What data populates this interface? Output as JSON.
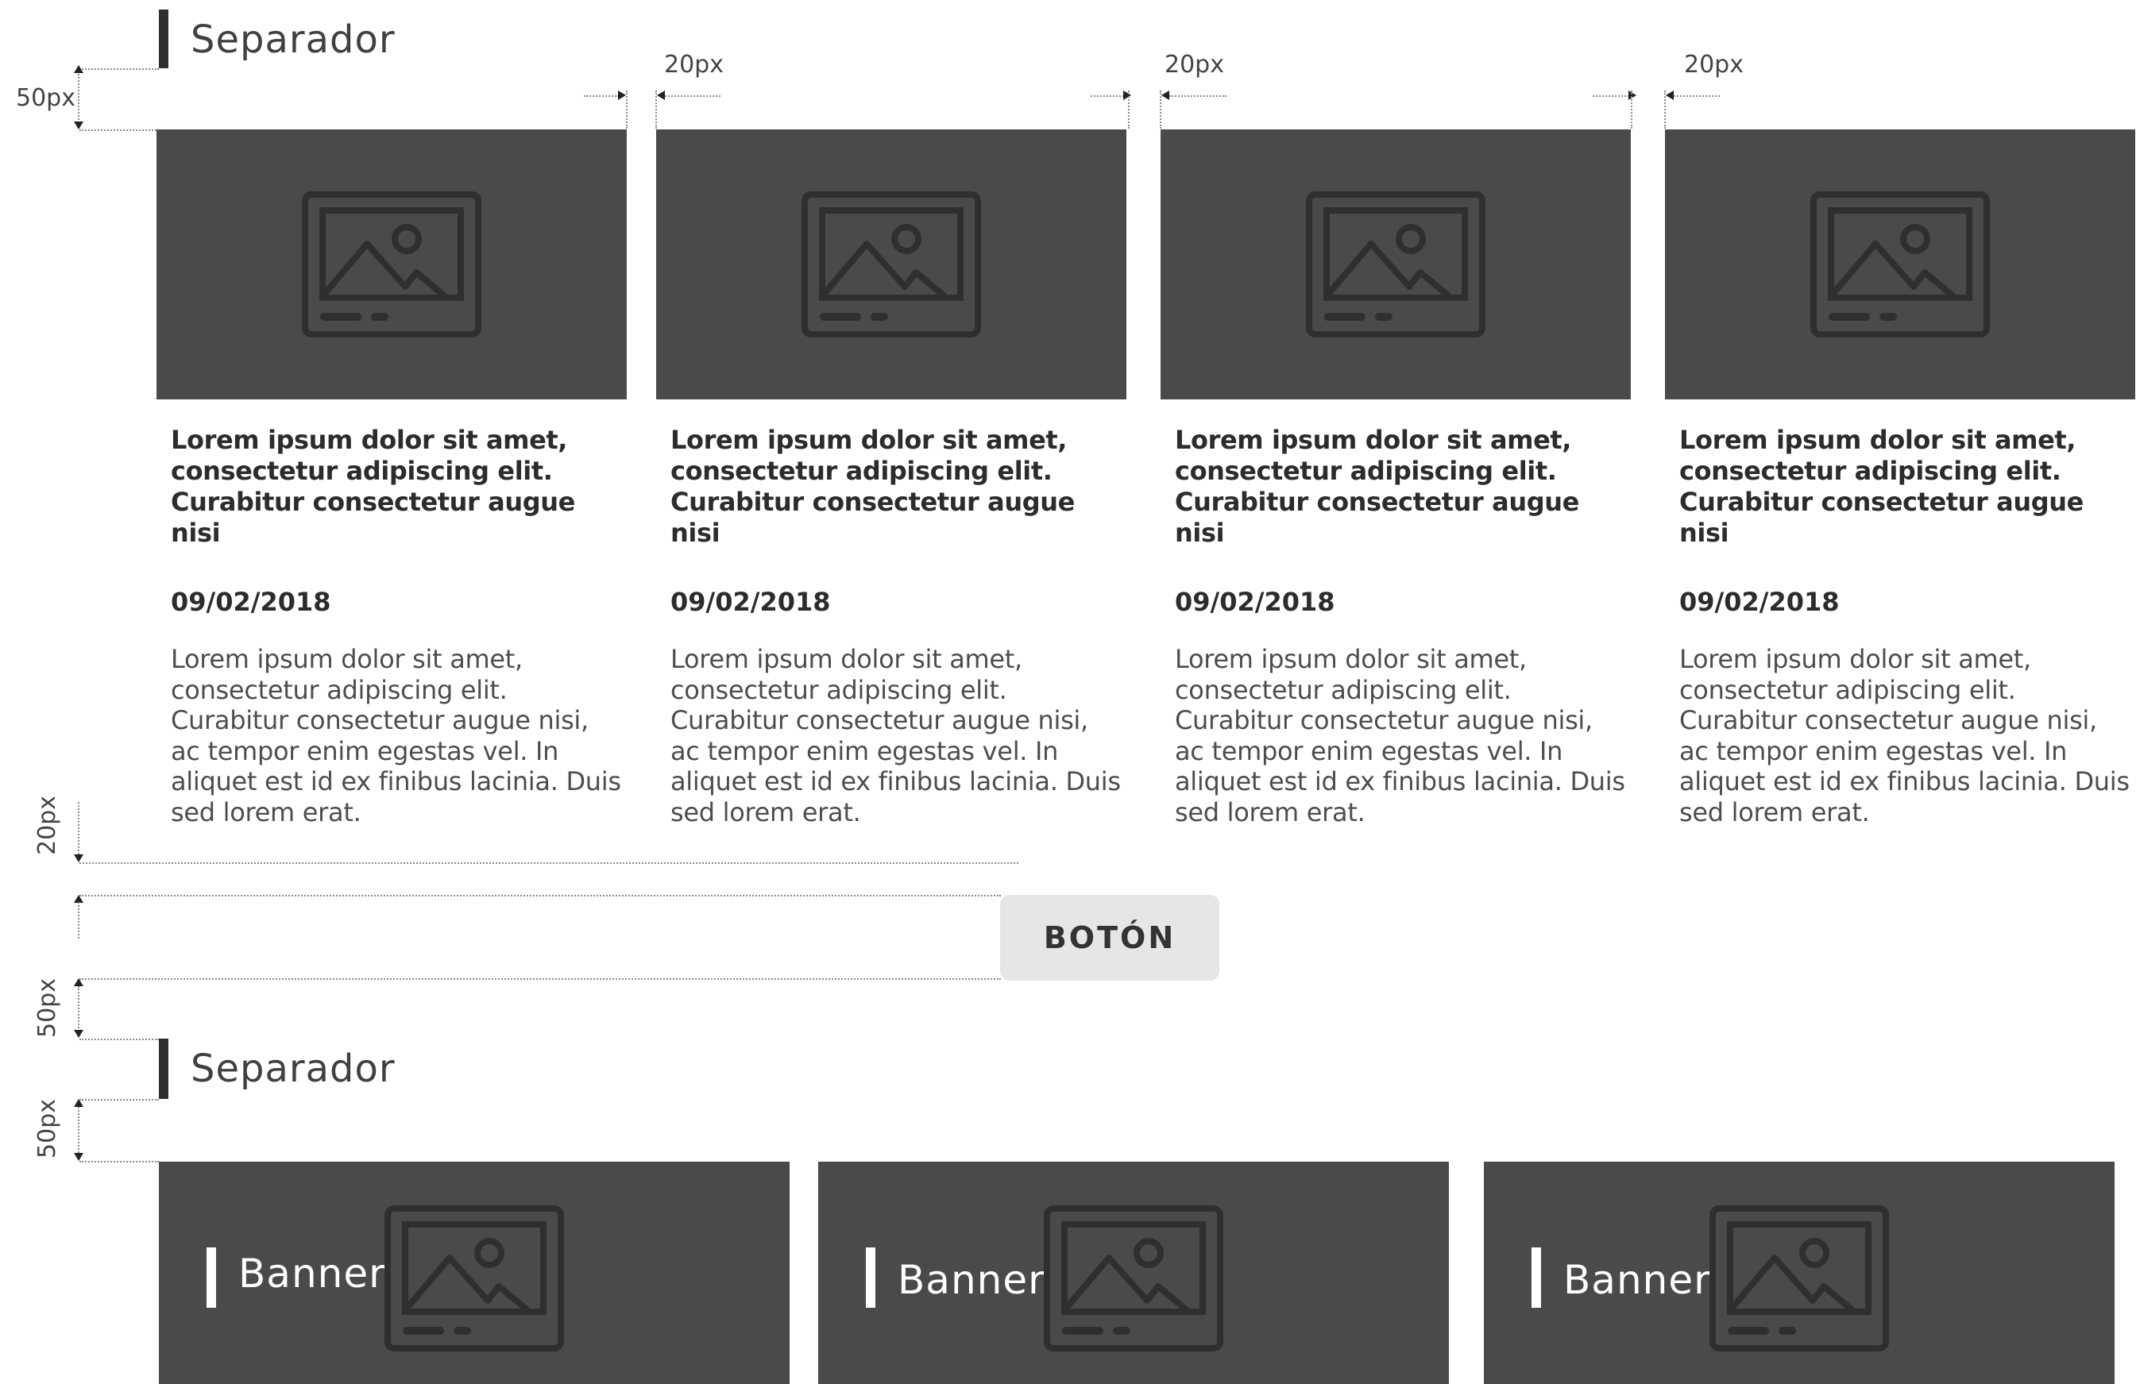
{
  "section_titles": [
    "Separador",
    "Separador"
  ],
  "dimensions": {
    "top_gap": "50px",
    "card_gap_1": "20px",
    "card_gap_2": "20px",
    "card_gap_3": "20px",
    "text_to_button": "20px",
    "button_to_separator": "50px",
    "separator_to_banners": "50px"
  },
  "cards": [
    {
      "title": "Lorem ipsum dolor sit amet, consectetur adipiscing elit. Curabitur consectetur augue nisi",
      "date": "09/02/2018",
      "body": "Lorem ipsum dolor sit amet, consectetur adipiscing elit. Curabitur consectetur augue nisi, ac tempor enim egestas vel. In aliquet est id ex finibus lacinia. Duis sed lorem erat."
    },
    {
      "title": "Lorem ipsum dolor sit amet, consectetur adipiscing elit. Curabitur consectetur augue nisi",
      "date": "09/02/2018",
      "body": "Lorem ipsum dolor sit amet, consectetur adipiscing elit. Curabitur consectetur augue nisi, ac tempor enim egestas vel. In aliquet est id ex finibus lacinia. Duis sed lorem erat."
    },
    {
      "title": "Lorem ipsum dolor sit amet, consectetur adipiscing elit. Curabitur consectetur augue nisi",
      "date": "09/02/2018",
      "body": "Lorem ipsum dolor sit amet, consectetur adipiscing elit. Curabitur consectetur augue nisi, ac tempor enim egestas vel. In aliquet est id ex finibus lacinia. Duis sed lorem erat."
    },
    {
      "title": "Lorem ipsum dolor sit amet, consectetur adipiscing elit. Curabitur consectetur augue nisi",
      "date": "09/02/2018",
      "body": "Lorem ipsum dolor sit amet, consectetur adipiscing elit. Curabitur consectetur augue nisi, ac tempor enim egestas vel. In aliquet est id ex finibus lacinia. Duis sed lorem erat."
    }
  ],
  "button_label": "BOTÓN",
  "banners": [
    {
      "label": "Banner"
    },
    {
      "label": "Banner"
    },
    {
      "label": "Banner"
    }
  ],
  "icons": {
    "card_image": "image-placeholder-icon",
    "banner_image": "image-placeholder-icon"
  },
  "colors": {
    "placeholder_fill": "#4a4a4a",
    "icon_stroke": "#2f2f2f",
    "button_fill": "#e6e6e6",
    "separator_bar": "#2f2f2f",
    "banner_accent": "#ffffff"
  }
}
